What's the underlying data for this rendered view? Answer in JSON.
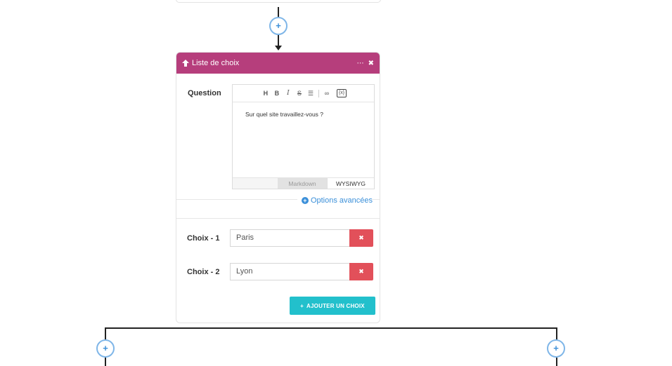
{
  "flow": {
    "top_plus_symbol": "+",
    "left_plus_symbol": "+",
    "right_plus_symbol": "+"
  },
  "card": {
    "header_icon": "arrow-up-icon",
    "title": "Liste de choix",
    "header_color": "#b63e7c",
    "more_icon": "⋯",
    "close_icon": "✖",
    "question_label": "Question",
    "toolbar": {
      "heading": "H",
      "bold": "B",
      "italic": "I",
      "strike": "S",
      "list": "☰",
      "link": "∞",
      "variable": "{x}"
    },
    "question_text": "Sur quel site travaillez-vous ?",
    "tab_markdown": "Markdown",
    "tab_wysiwyg": "WYSIWYG",
    "advanced_options_icon": "+",
    "advanced_options": "Options avancées",
    "choices": [
      {
        "label": "Choix - 1",
        "value": "Paris",
        "delete": "✖"
      },
      {
        "label": "Choix - 2",
        "value": "Lyon",
        "delete": "✖"
      }
    ],
    "add_choice_icon": "+",
    "add_choice": "AJOUTER UN CHOIX",
    "delete_color": "#e2505a",
    "add_color": "#22c0cc",
    "link_color": "#3a8fd9"
  }
}
